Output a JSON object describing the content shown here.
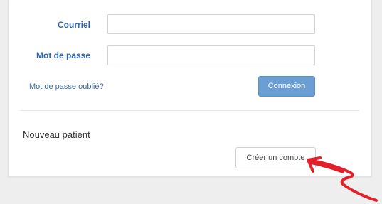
{
  "login": {
    "email_label": "Courriel",
    "email_value": "",
    "password_label": "Mot de passe",
    "password_value": "",
    "forgot_link": "Mot de passe oublié?",
    "submit_label": "Connexion"
  },
  "new_patient": {
    "title": "Nouveau patient",
    "create_account_label": "Créer un compte"
  },
  "colors": {
    "label_blue": "#2f66ac",
    "button_blue": "#6b9fd3",
    "annotation_red": "#e3202a"
  },
  "icons": {
    "annotation": "red-arrow-icon"
  }
}
